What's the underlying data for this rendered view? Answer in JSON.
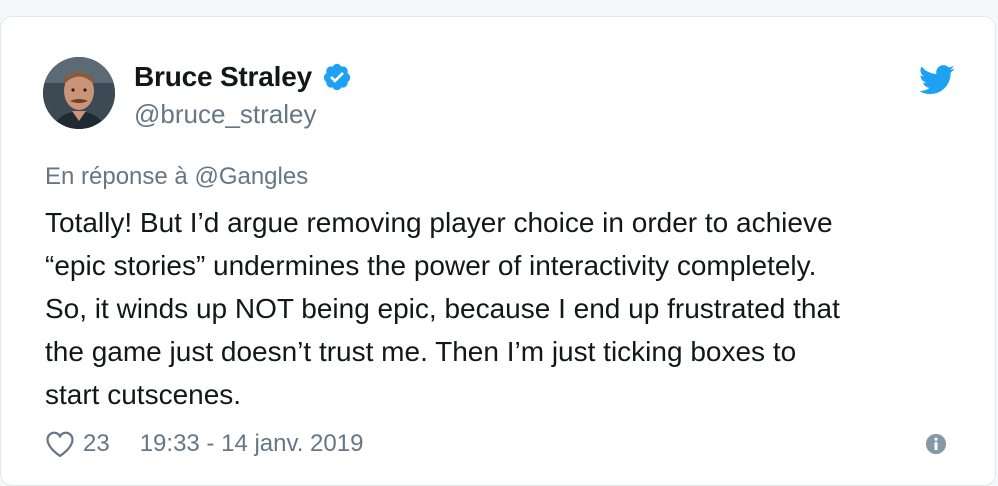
{
  "author": {
    "display_name": "Bruce Straley",
    "handle": "@bruce_straley",
    "verified": true
  },
  "reply": {
    "prefix": "En réponse à",
    "mention": "@Gangles"
  },
  "tweet": {
    "line1": "Totally! But I’d argue removing player choice in order to achieve",
    "line2": "“epic stories” undermines the power of interactivity completely.",
    "line3": "So, it winds up NOT being epic, because I end up frustrated that",
    "line4": "the game just doesn’t trust me. Then I’m just ticking boxes to",
    "line5": "start cutscenes."
  },
  "footer": {
    "like_count": "23",
    "timestamp": "19:33 - 14 janv. 2019"
  },
  "icons": {
    "verified": "verified-badge-icon",
    "brand": "twitter-bird-icon",
    "like": "heart-outline-icon",
    "info": "info-circle-icon"
  },
  "colors": {
    "brand_blue": "#1da1f2",
    "text_primary": "#14171a",
    "text_secondary": "#657786"
  }
}
